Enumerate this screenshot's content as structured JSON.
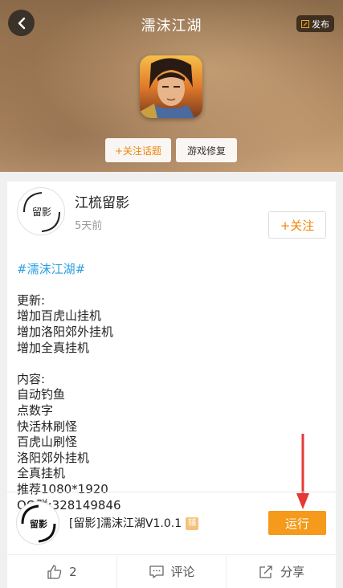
{
  "header": {
    "title": "濡沫江湖",
    "publish_label": "发布",
    "follow_topic_label": "+关注话题",
    "repair_label": "游戏修复"
  },
  "post": {
    "author": "江梳留影",
    "avatar_text": "留影",
    "time": "5天前",
    "follow_label": "+关注",
    "hashtag": "#濡沫江湖#",
    "body": "更新:\n增加百虎山挂机\n增加洛阳郊外挂机\n增加全真挂机\n\n内容:\n自动钓鱼\n点数字\n快活林刷怪\n百虎山刷怪\n洛阳郊外挂机\n全真挂机\n推荐1080*1920\nQQ群:328149846"
  },
  "app": {
    "logo_text": "留影",
    "name": "[留影]濡沫江湖V1.0.1",
    "badge": "辅",
    "run_label": "运行"
  },
  "actions": {
    "like_count": "2",
    "comment_label": "评论",
    "share_label": "分享"
  },
  "colors": {
    "accent": "#f59a1a",
    "hashtag": "#2a9ee0",
    "arrow": "#e53935"
  }
}
